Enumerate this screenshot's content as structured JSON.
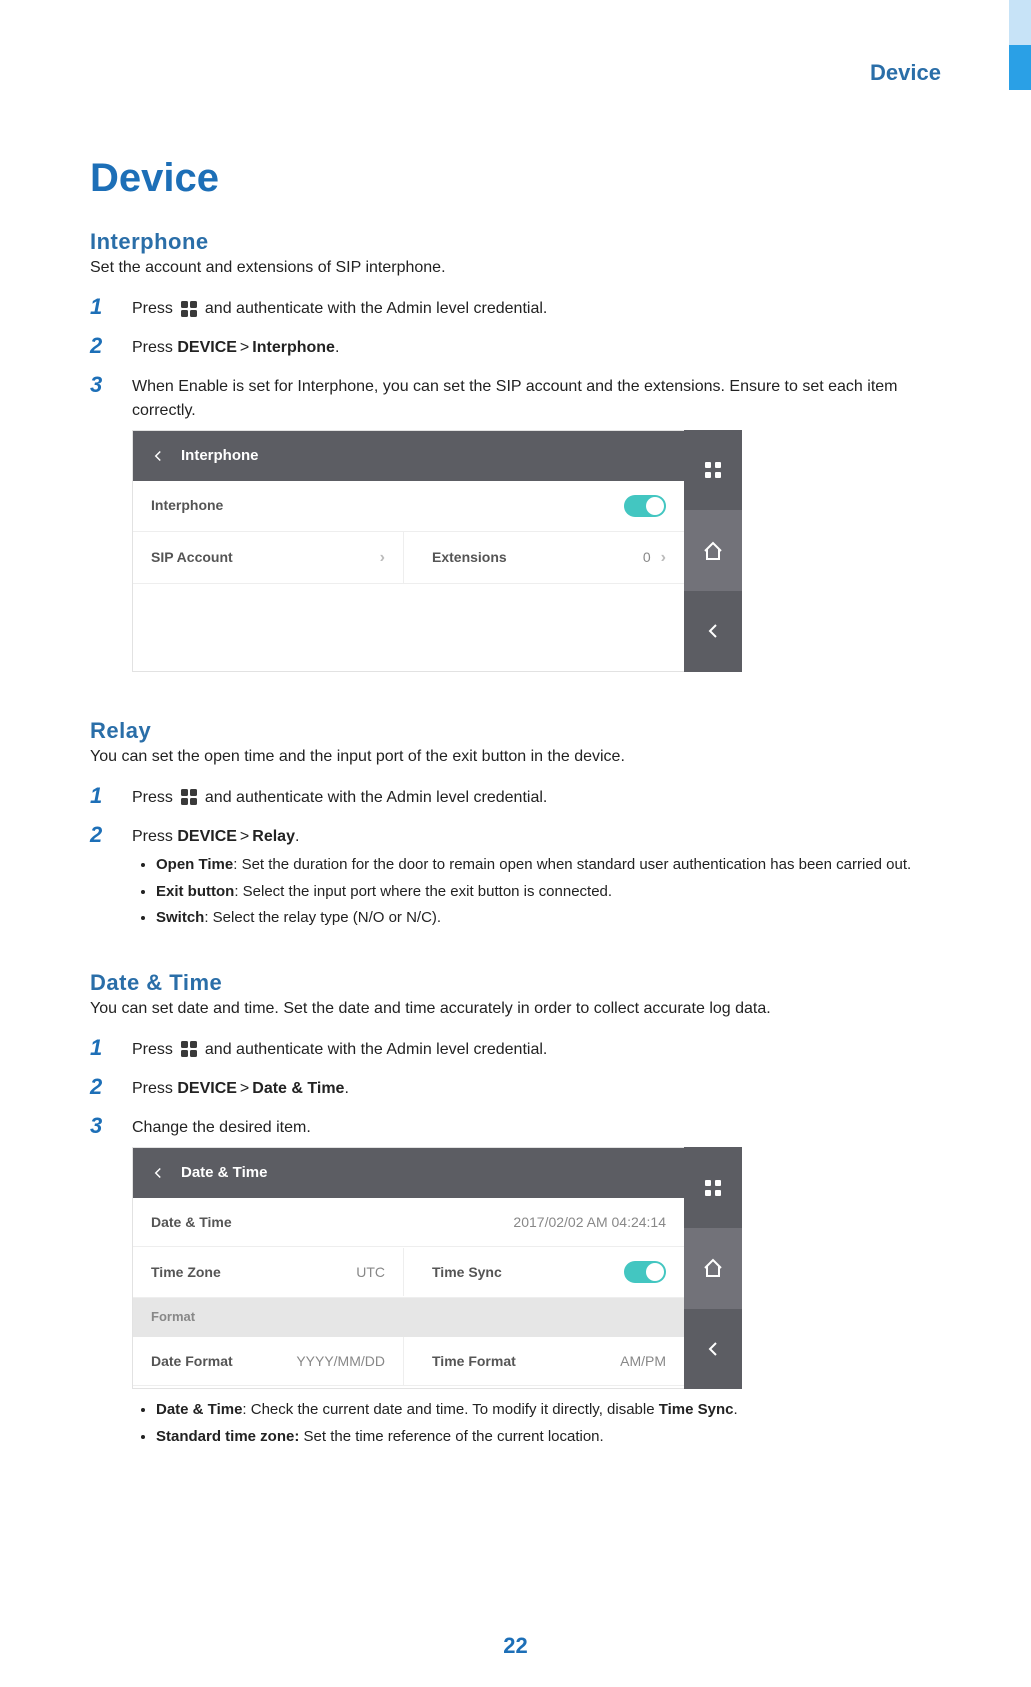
{
  "header": {
    "label": "Device"
  },
  "title": "Device",
  "page_number": "22",
  "interphone": {
    "heading": "Interphone",
    "intro": "Set the account and extensions of SIP interphone.",
    "step1_a": "Press",
    "step1_b": "and authenticate with the Admin level credential.",
    "step2_a": "Press ",
    "step2_b": "DEVICE",
    "step2_c": "Interphone",
    "step2_d": ".",
    "step3": "When Enable is set for Interphone, you can set the SIP account and the extensions. Ensure to set each item correctly.",
    "shot": {
      "title": "Interphone",
      "row1": "Interphone",
      "row2a": "SIP Account",
      "row2b_label": "Extensions",
      "row2b_val": "0"
    }
  },
  "relay": {
    "heading": "Relay",
    "intro": "You can set the open time and the input port of the exit button in the device.",
    "step1_a": "Press",
    "step1_b": "and authenticate with the Admin level credential.",
    "step2_a": "Press ",
    "step2_b": "DEVICE",
    "step2_c": "Relay",
    "step2_d": ".",
    "b1_t": "Open Time",
    "b1_d": ": Set the duration for the door to remain open when standard user authentication has been carried out.",
    "b2_t": "Exit button",
    "b2_d": ": Select the input port where the exit button is connected.",
    "b3_t": "Switch",
    "b3_d": ": Select the relay type (N/O or N/C)."
  },
  "datetime": {
    "heading": "Date  &  Time",
    "intro": "You can set date and time. Set the date and time accurately in order to collect accurate log data.",
    "step1_a": "Press",
    "step1_b": "and authenticate with the Admin level credential.",
    "step2_a": "Press ",
    "step2_b": "DEVICE",
    "step2_c": "Date & Time",
    "step2_d": ".",
    "step3": "Change the desired item.",
    "shot": {
      "title": "Date & Time",
      "r1_label": "Date & Time",
      "r1_val": "2017/02/02 AM 04:24:14",
      "r2a_label": "Time Zone",
      "r2a_val": "UTC",
      "r2b_label": "Time Sync",
      "sec": "Format",
      "r3a_label": "Date Format",
      "r3a_val": "YYYY/MM/DD",
      "r3b_label": "Time Format",
      "r3b_val": "AM/PM"
    },
    "b1_t": "Date & Time",
    "b1_d": ": Check the current date and time. To modify it directly, disable ",
    "b1_e": "Time Sync",
    "b1_f": ".",
    "b2_t": "Standard time zone:",
    "b2_d": " Set the time reference of the current location."
  }
}
